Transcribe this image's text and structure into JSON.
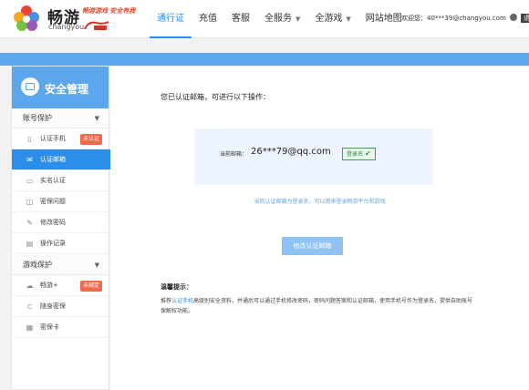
{
  "header": {
    "brand_cn": "畅游",
    "brand_en": "changyou",
    "slogan": "畅游游戏 安全有我",
    "nav": [
      {
        "label": "通行证",
        "active": true,
        "dropdown": false
      },
      {
        "label": "充值",
        "active": false,
        "dropdown": false
      },
      {
        "label": "客服",
        "active": false,
        "dropdown": false
      },
      {
        "label": "全服务",
        "active": false,
        "dropdown": true
      },
      {
        "label": "全游戏",
        "active": false,
        "dropdown": true
      },
      {
        "label": "网站地图",
        "active": false,
        "dropdown": false
      }
    ],
    "welcome_prefix": "欢迎您：",
    "account": "40***39@changyou.com",
    "logout_label": "退出"
  },
  "sidebar": {
    "title": "安全管理",
    "sections": [
      {
        "label": "账号保护",
        "items": [
          {
            "label": "认证手机",
            "icon": "phone-icon",
            "badge": "未认证",
            "active": false
          },
          {
            "label": "认证邮箱",
            "icon": "mail-icon",
            "badge": "",
            "active": true
          },
          {
            "label": "实名认证",
            "icon": "id-card-icon",
            "badge": "",
            "active": false
          },
          {
            "label": "密保问题",
            "icon": "question-icon",
            "badge": "",
            "active": false
          },
          {
            "label": "修改密码",
            "icon": "pencil-icon",
            "badge": "",
            "active": false
          },
          {
            "label": "操作记录",
            "icon": "record-icon",
            "badge": "",
            "active": false
          }
        ]
      },
      {
        "label": "游戏保护",
        "items": [
          {
            "label": "畅游+",
            "icon": "changyou-plus-icon",
            "badge": "未绑定",
            "active": false
          },
          {
            "label": "随身密保",
            "icon": "token-icon",
            "badge": "",
            "active": false
          },
          {
            "label": "密保卡",
            "icon": "grid-card-icon",
            "badge": "",
            "active": false
          }
        ]
      }
    ]
  },
  "main": {
    "heading": "您已认证邮箱，可进行以下操作：",
    "email_label": "当前邮箱：",
    "email_value": "26***79@qq.com",
    "login_badge": "登录名",
    "hint": "当前认证邮箱为登录名，可以用来登录畅游平台和游戏",
    "modify_button": "修改认证邮箱",
    "tips_title": "温馨提示：",
    "tips_prefix": "推荐",
    "tips_link": "认证手机",
    "tips_text": "高级别安全资料，并通后可以通过手机修改密码，密码问题答案和认证邮箱，使用手机号作为登录名，提供自助账号保解权功能。"
  },
  "colors": {
    "accent": "#2c8ee8",
    "band": "#5ba6ec",
    "badge_red": "#f06a4a",
    "button_disabled": "#8fc3f4",
    "verified_green": "#3aa35a"
  }
}
